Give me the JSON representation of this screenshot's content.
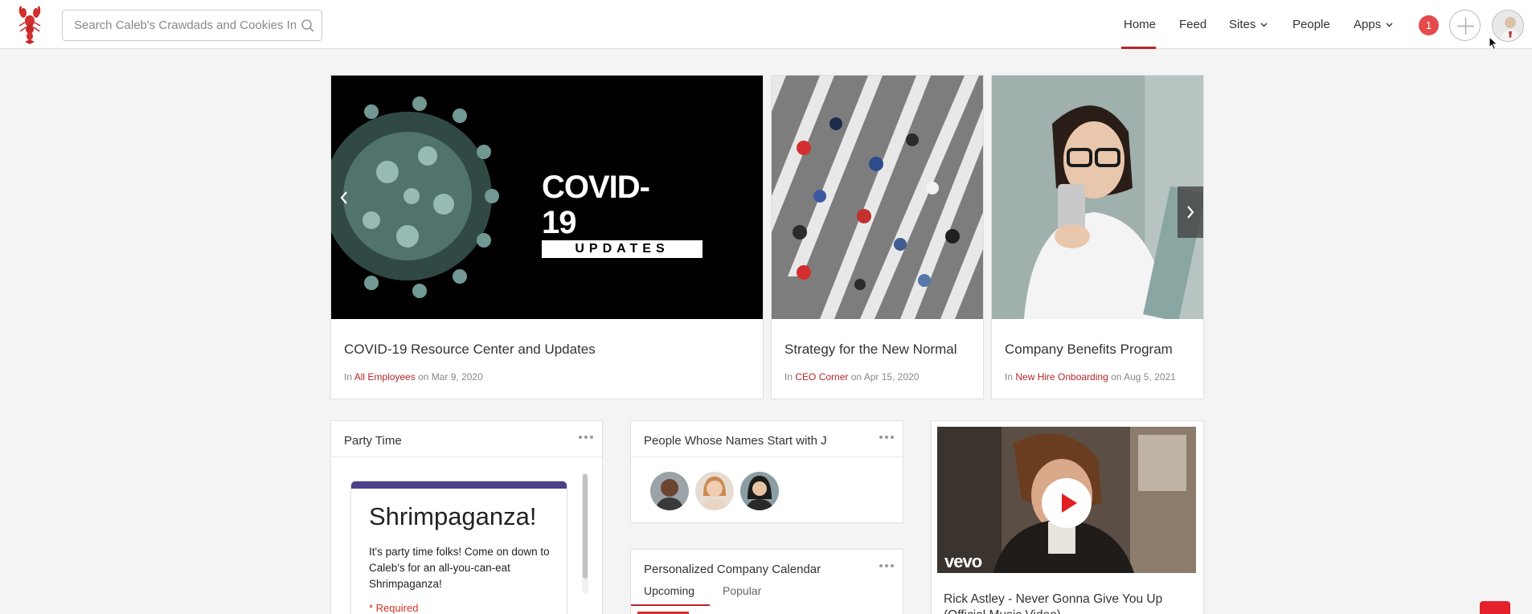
{
  "search": {
    "placeholder": "Search Caleb's Crawdads and Cookies Intranet"
  },
  "nav": {
    "items": [
      {
        "label": "Home"
      },
      {
        "label": "Feed"
      },
      {
        "label": "Sites"
      },
      {
        "label": "People"
      },
      {
        "label": "Apps"
      }
    ],
    "active": "Home",
    "notification_count": "1"
  },
  "colors": {
    "accent": "#b3262b",
    "badge": "#e54b4b",
    "form_bar": "#4b3f88"
  },
  "carousel": {
    "cards": [
      {
        "title": "COVID-19 Resource Center and Updates",
        "meta_prefix": "In",
        "site": "All Employees",
        "date": "on Mar 9, 2020",
        "image_text_1": "COVID-19",
        "image_text_2": "UPDATES"
      },
      {
        "title": "Strategy for the New Normal",
        "meta_prefix": "In",
        "site": "CEO Corner",
        "date": "on Apr 15, 2020"
      },
      {
        "title": "Company Benefits Program",
        "meta_prefix": "In",
        "site": "New Hire Onboarding",
        "date": "on Aug 5, 2021"
      }
    ]
  },
  "widgets": {
    "party": {
      "title": "Party Time",
      "form_title": "Shrimpaganza!",
      "form_body": "It's party time folks! Come on down to Caleb's for an all-you-can-eat Shrimpaganza!",
      "form_required": "* Required"
    },
    "people": {
      "title": "People Whose Names Start with J"
    },
    "calendar": {
      "title": "Personalized Company Calendar",
      "tabs": [
        "Upcoming",
        "Popular"
      ],
      "active_tab": "Upcoming"
    },
    "video": {
      "title": "Rick Astley - Never Gonna Give You Up (Official Music Video)",
      "brand": "vevo"
    }
  }
}
